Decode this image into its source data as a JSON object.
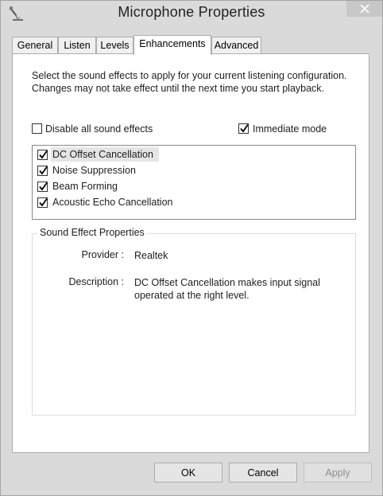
{
  "window": {
    "title": "Microphone Properties",
    "icon": "microphone-icon",
    "close_icon": "close-icon"
  },
  "tabs": [
    {
      "label": "General",
      "active": false
    },
    {
      "label": "Listen",
      "active": false
    },
    {
      "label": "Levels",
      "active": false
    },
    {
      "label": "Enhancements",
      "active": true
    },
    {
      "label": "Advanced",
      "active": false
    }
  ],
  "content": {
    "description": "Select the sound effects to apply for your current listening configuration. Changes may not take effect until the next time you start playback.",
    "disable_all": {
      "label": "Disable all sound effects",
      "checked": false
    },
    "immediate_mode": {
      "label": "Immediate mode",
      "checked": true
    },
    "effects": [
      {
        "label": "DC Offset Cancellation",
        "checked": true,
        "selected": true
      },
      {
        "label": "Noise Suppression",
        "checked": true,
        "selected": false
      },
      {
        "label": "Beam Forming",
        "checked": true,
        "selected": false
      },
      {
        "label": "Acoustic Echo Cancellation",
        "checked": true,
        "selected": false
      }
    ],
    "properties": {
      "group_title": "Sound Effect Properties",
      "provider_label": "Provider :",
      "provider_value": "Realtek",
      "description_label": "Description :",
      "description_value": "DC Offset Cancellation makes input signal operated at the right level."
    }
  },
  "buttons": {
    "ok": "OK",
    "cancel": "Cancel",
    "apply": "Apply",
    "apply_enabled": false
  },
  "colors": {
    "window_bg": "#dadada",
    "panel_bg": "#ffffff",
    "selection": "#e5e5e5",
    "disabled_text": "#8e8e8e"
  }
}
